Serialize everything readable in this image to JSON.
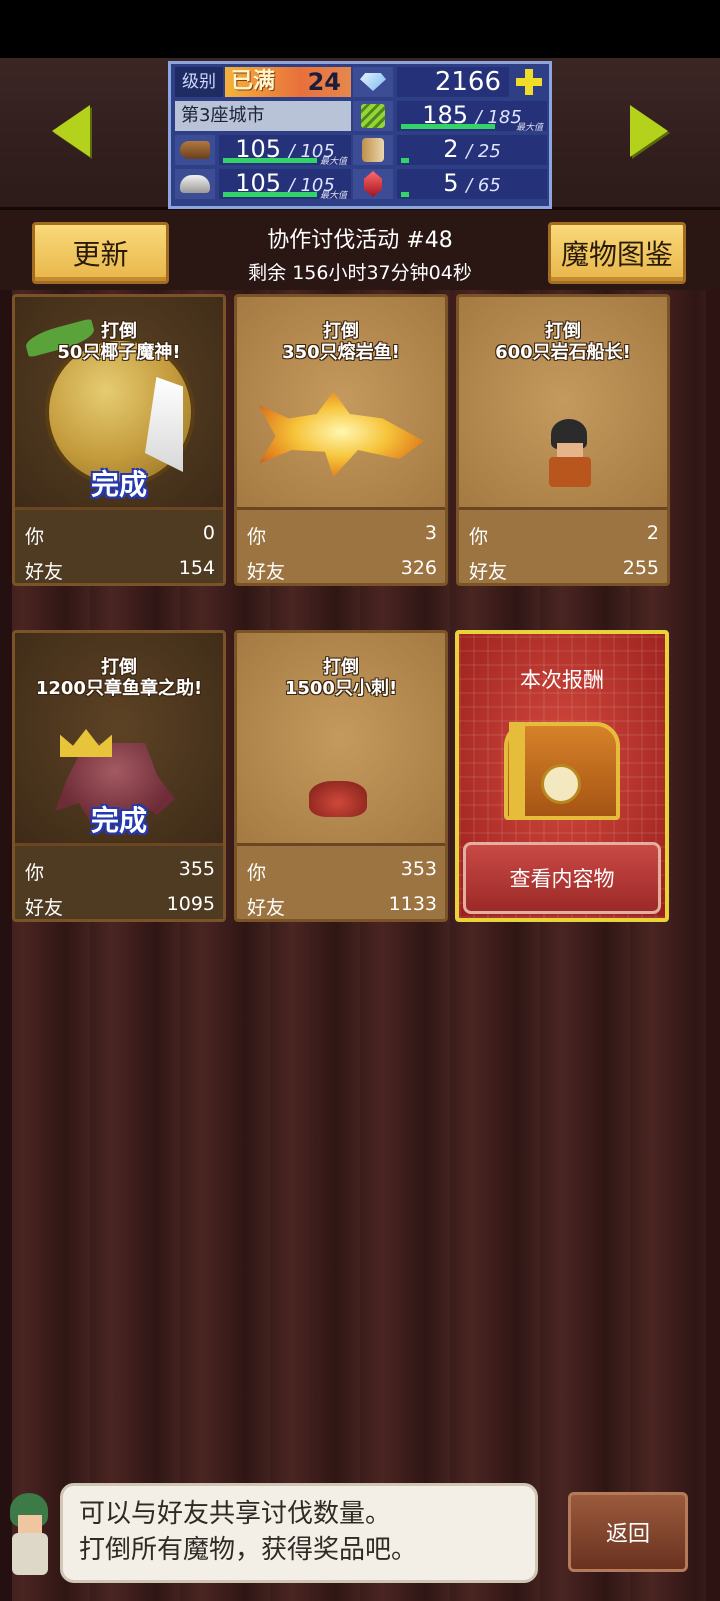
{
  "status": {
    "level_label": "级别",
    "level_status": "已满",
    "level_value": "24",
    "gems": "2166",
    "city_name": "第3座城市",
    "resources": {
      "leaf": {
        "value": "185",
        "cap": "185",
        "max_tag": "最大值"
      },
      "wood": {
        "value": "105",
        "cap": "105",
        "max_tag": "最大值"
      },
      "food": {
        "value": "2",
        "cap": "25"
      },
      "stone": {
        "value": "105",
        "cap": "105",
        "max_tag": "最大值"
      },
      "ruby": {
        "value": "5",
        "cap": "65"
      }
    }
  },
  "header": {
    "update_label": "更新",
    "guide_label": "魔物图鉴",
    "event_title": "协作讨伐活动 #48",
    "event_timer": "剩余 156小时37分钟04秒"
  },
  "cards": [
    {
      "task_line1": "打倒",
      "task_line2": "50只椰子魔神!",
      "done_label": "完成",
      "you_label": "你",
      "you_value": "0",
      "friend_label": "好友",
      "friend_value": "154"
    },
    {
      "task_line1": "打倒",
      "task_line2": "350只熔岩鱼!",
      "you_label": "你",
      "you_value": "3",
      "friend_label": "好友",
      "friend_value": "326"
    },
    {
      "task_line1": "打倒",
      "task_line2": "600只岩石船长!",
      "you_label": "你",
      "you_value": "2",
      "friend_label": "好友",
      "friend_value": "255"
    },
    {
      "task_line1": "打倒",
      "task_line2": "1200只章鱼章之助!",
      "done_label": "完成",
      "you_label": "你",
      "you_value": "355",
      "friend_label": "好友",
      "friend_value": "1095"
    },
    {
      "task_line1": "打倒",
      "task_line2": "1500只小刺!",
      "you_label": "你",
      "you_value": "353",
      "friend_label": "好友",
      "friend_value": "1133"
    }
  ],
  "reward": {
    "title": "本次报酬",
    "view_contents_label": "查看内容物"
  },
  "hint": {
    "line1": "可以与好友共享讨伐数量。",
    "line2": "打倒所有魔物，获得奖品吧。"
  },
  "back_label": "返回",
  "icons": [
    "left-arrow-icon",
    "right-arrow-icon",
    "gem-icon",
    "plus-icon",
    "leaf-icon",
    "wood-icon",
    "food-icon",
    "stone-icon",
    "ruby-icon",
    "chest-icon"
  ],
  "colors": {
    "accent_gold": "#f9d979",
    "nav_arrow": "#b4d21c",
    "reward_red": "#c94945",
    "panel_blue": "#2f3f86"
  }
}
